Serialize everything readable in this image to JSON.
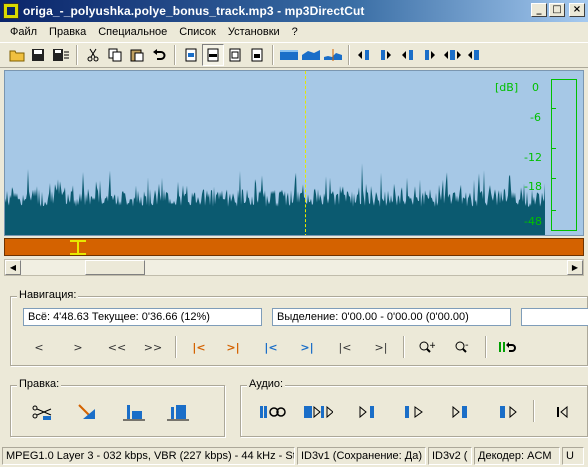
{
  "window": {
    "title": "origa_-_polyushka.polye_bonus_track.mp3 - mp3DirectCut",
    "minimize": "_",
    "maximize": "□",
    "close": "×"
  },
  "menu": [
    "Файл",
    "Правка",
    "Специальное",
    "Список",
    "Установки",
    "?"
  ],
  "toolbar": {
    "icons": [
      "open-folder-icon",
      "save-icon",
      "save-list-icon",
      "cut-icon",
      "copy-icon",
      "paste-icon",
      "undo-icon",
      "page-view-1-icon",
      "page-view-2-icon",
      "page-view-3-icon",
      "volume-envelope-1-icon",
      "volume-envelope-2-icon",
      "volume-envelope-3-icon",
      "marker-1-icon",
      "marker-2-icon",
      "marker-3-icon",
      "marker-4-icon",
      "marker-5-icon",
      "marker-6-icon"
    ]
  },
  "waveform": {
    "db_unit": "[dB]",
    "db_scale": [
      "0",
      "-6",
      "-12",
      "-18",
      "-48"
    ],
    "colors": {
      "background": "#a6c8e6",
      "wave": "#0b5a70",
      "meter": "#00c000",
      "cursor": "#e8e800"
    },
    "cursor_position_fraction": 0.52
  },
  "range_bar": {
    "color": "#d46200",
    "marker_color": "#e8e800"
  },
  "navigation": {
    "label": "Навигация:",
    "total_current": "Всё: 4'48.63  Текущее: 0'36.66  (12%)",
    "selection": "Выделение: 0'00.00 - 0'00.00 (0'00.00)",
    "buttons": [
      "<",
      ">",
      "<<",
      ">>",
      "|<",
      ">|",
      "|<",
      ">|",
      "|<",
      ">|",
      "+",
      "-",
      "||"
    ]
  },
  "edit": {
    "label": "Правка:"
  },
  "audio": {
    "label": "Аудио:"
  },
  "status": {
    "format": "MPEG1.0 Layer 3 - 032 kbps, VBR (227 kbps) - 44 kHz - Ste",
    "id3v1": "ID3v1 (Сохранение: Да)",
    "id3v2": "ID3v2 (",
    "decoder": "Декодер: ACM",
    "extra": "U"
  }
}
